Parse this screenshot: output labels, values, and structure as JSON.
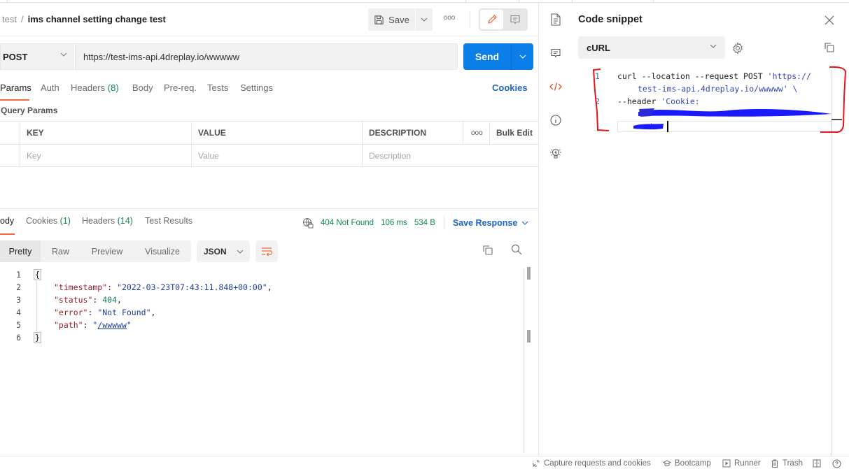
{
  "header": {
    "breadcrumb_parent": "test",
    "breadcrumb_sep": "/",
    "request_name": "ims channel setting change test",
    "save_label": "Save",
    "more_label": "ooo"
  },
  "request": {
    "method": "POST",
    "url": "https://test-ims-api.4dreplay.io/wwwww",
    "send_label": "Send"
  },
  "request_tabs": [
    {
      "label": "Params",
      "count": ""
    },
    {
      "label": "Auth",
      "count": ""
    },
    {
      "label": "Headers",
      "count": "(8)"
    },
    {
      "label": "Body",
      "count": ""
    },
    {
      "label": "Pre-req.",
      "count": ""
    },
    {
      "label": "Tests",
      "count": ""
    },
    {
      "label": "Settings",
      "count": ""
    }
  ],
  "cookies_link": "Cookies",
  "query_params": {
    "title": "Query Params",
    "columns": [
      "KEY",
      "VALUE",
      "DESCRIPTION"
    ],
    "more_label": "ooo",
    "bulk_edit": "Bulk Edit",
    "placeholders": {
      "key": "Key",
      "value": "Value",
      "description": "Description"
    }
  },
  "response_tabs": [
    {
      "label": "ody",
      "count": ""
    },
    {
      "label": "Cookies",
      "count": "(1)"
    },
    {
      "label": "Headers",
      "count": "(14)"
    },
    {
      "label": "Test Results",
      "count": ""
    }
  ],
  "response_status": {
    "status": "404 Not Found",
    "time": "106 ms",
    "size": "534 B",
    "save_response": "Save Response"
  },
  "response_view": {
    "modes": [
      "Pretty",
      "Raw",
      "Preview",
      "Visualize"
    ],
    "active_mode": "Pretty",
    "format": "JSON"
  },
  "response_body": {
    "line_numbers": [
      "1",
      "2",
      "3",
      "4",
      "5",
      "6"
    ],
    "open_brace": "{",
    "close_brace": "}",
    "timestamp_key": "\"timestamp\"",
    "timestamp_value": "\"2022-03-23T07:43:11.848+00:00\"",
    "status_key": "\"status\"",
    "status_value": "404",
    "error_key": "\"error\"",
    "error_value": "\"Not Found\"",
    "path_key": "\"path\"",
    "path_value": "/wwwww"
  },
  "code_snippet": {
    "title": "Code snippet",
    "language": "cURL",
    "lines": [
      {
        "num": "1",
        "text": "curl --location --request POST ",
        "str": "'https://",
        "cont": "test-ims-api.4dreplay.io/wwwww' \\"
      },
      {
        "num": "2",
        "text": "--header ",
        "str": "'Cookie:",
        "cont": "'"
      }
    ]
  },
  "statusbar": {
    "capture": "Capture requests and cookies",
    "bootcamp": "Bootcamp",
    "runner": "Runner",
    "trash": "Trash"
  },
  "colors": {
    "accent_orange": "#f26b3a",
    "send_blue": "#0c7ee8",
    "link_blue": "#1d63c9",
    "status_green": "#0f8a4f",
    "annotation_red": "#e8141c",
    "redaction_blue": "#1a1aff"
  }
}
